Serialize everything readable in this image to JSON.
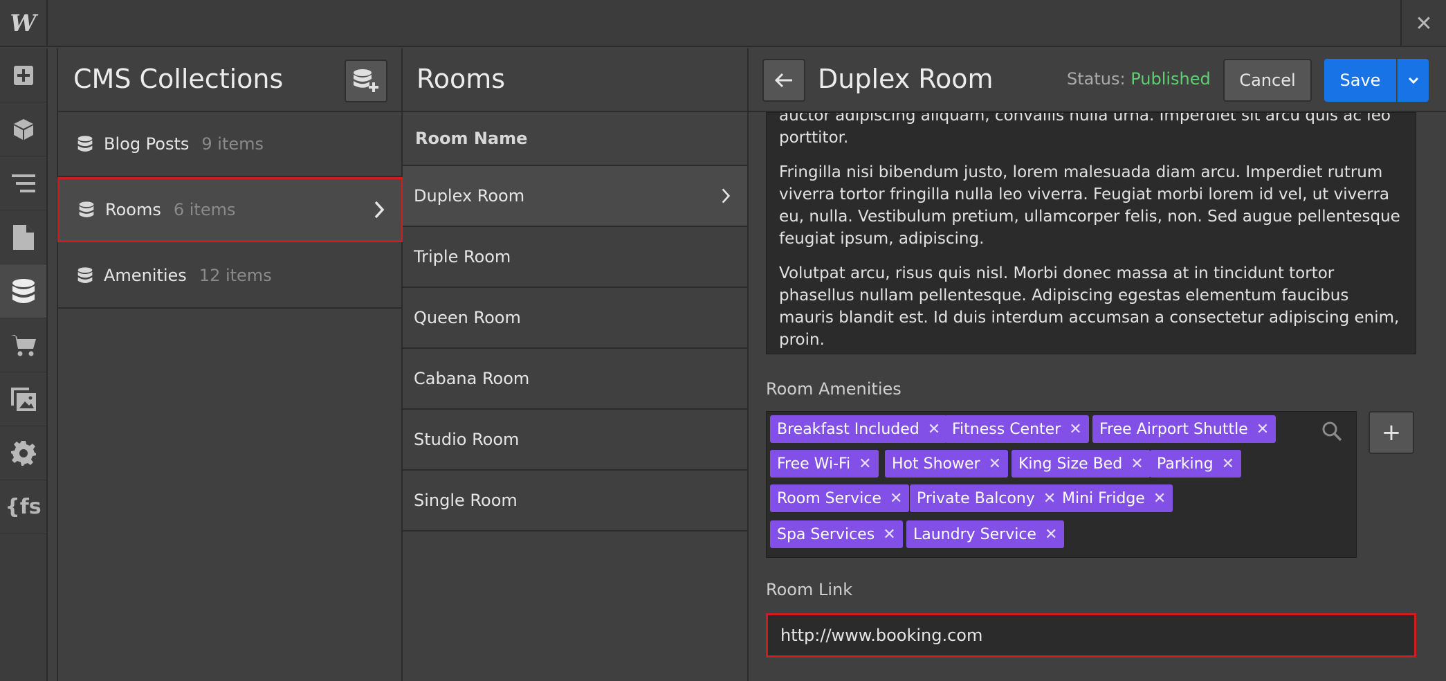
{
  "app": {
    "logo": "W",
    "close": "✕"
  },
  "rail": {
    "items": [
      {
        "icon": "plus-square-icon"
      },
      {
        "icon": "cube-icon"
      },
      {
        "icon": "navigator-icon"
      },
      {
        "icon": "page-icon"
      },
      {
        "icon": "database-icon",
        "active": true
      },
      {
        "icon": "cart-icon"
      },
      {
        "icon": "assets-icon"
      },
      {
        "icon": "gear-icon"
      },
      {
        "icon": "fs-icon",
        "text": "{fs"
      }
    ]
  },
  "collections": {
    "title": "CMS Collections",
    "items": [
      {
        "name": "Blog Posts",
        "count": "9 items"
      },
      {
        "name": "Rooms",
        "count": "6 items",
        "selected": true
      },
      {
        "name": "Amenities",
        "count": "12 items"
      }
    ]
  },
  "rooms": {
    "title": "Rooms",
    "column": "Room Name",
    "rows": [
      "Duplex Room",
      "Triple Room",
      "Queen Room",
      "Cabana Room",
      "Studio Room",
      "Single Room"
    ]
  },
  "editor": {
    "title": "Duplex Room",
    "status_label": "Status:",
    "status_value": "Published",
    "cancel": "Cancel",
    "save": "Save",
    "body": {
      "p0_cut": "auctor adipiscing aliquam, convallis nulla urna. Imperdiet sit arcu quis ac leo",
      "p0_end": "porttitor.",
      "p1": "Fringilla nisi bibendum justo, lorem malesuada diam arcu. Imperdiet rutrum viverra tortor fringilla nulla leo viverra. Feugiat morbi lorem id vel, ut viverra eu, nulla. Vestibulum pretium, ullamcorper felis, non. Sed augue pellentesque feugiat ipsum, adipiscing.",
      "p2": "Volutpat arcu, risus quis nisl. Morbi donec massa at in tincidunt tortor phasellus nullam pellentesque. Adipiscing egestas elementum faucibus mauris blandit est. Id duis interdum accumsan a consectetur adipiscing enim, proin."
    },
    "amenities_label": "Room Amenities",
    "amenities": [
      "Breakfast Included",
      "Fitness Center",
      "Free Airport Shuttle",
      "Free Wi-Fi",
      "Hot Shower",
      "King Size Bed",
      "Parking",
      "Room Service",
      "Private Balcony",
      "Mini Fridge",
      "Spa Services",
      "Laundry Service"
    ],
    "tag_remove": "✕",
    "add": "+",
    "link_label": "Room Link",
    "link_value": "http://www.booking.com"
  },
  "colors": {
    "accent": "#1874e6",
    "tag": "#8250e6",
    "published": "#5fcf72",
    "highlight": "#d21b1b"
  }
}
